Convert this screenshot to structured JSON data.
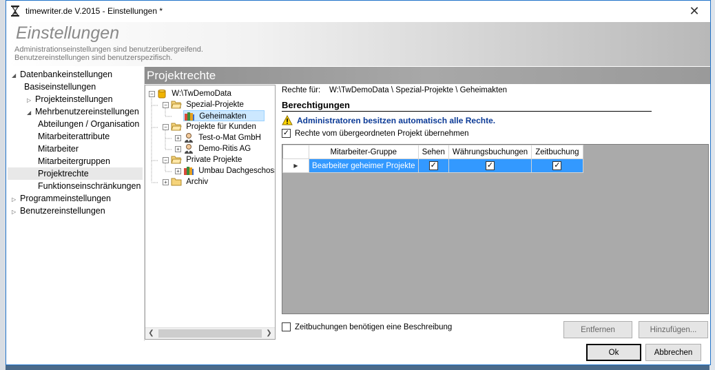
{
  "window": {
    "title": "timewriter.de V.2015 - Einstellungen *",
    "close_glyph": "✕"
  },
  "banner": {
    "heading": "Einstellungen",
    "line1": "Administrationseinstellungen sind benutzerübergreifend.",
    "line2": "Benutzereinstellungen sind benutzerspezifisch."
  },
  "nav": {
    "items": [
      {
        "label": "Datenbankeinstellungen",
        "tri": "◢"
      },
      {
        "label": "Basiseinstellungen"
      },
      {
        "label": "Projekteinstellungen",
        "tri": "▷"
      },
      {
        "label": "Mehrbenutzereinstellungen",
        "tri": "◢"
      },
      {
        "label": "Abteilungen / Organisation"
      },
      {
        "label": "Mitarbeiterattribute"
      },
      {
        "label": "Mitarbeiter"
      },
      {
        "label": "Mitarbeitergruppen"
      },
      {
        "label": "Projektrechte"
      },
      {
        "label": "Funktionseinschränkungen"
      },
      {
        "label": "Programmeinstellungen",
        "tri": "▷"
      },
      {
        "label": "Benutzereinstellungen",
        "tri": "▷"
      }
    ]
  },
  "content": {
    "header": "Projektrechte"
  },
  "ptree": {
    "nodes": [
      {
        "label": "W:\\TwDemoData"
      },
      {
        "label": "Spezial-Projekte"
      },
      {
        "label": "Geheimakten"
      },
      {
        "label": "Projekte für Kunden"
      },
      {
        "label": "Test-o-Mat GmbH"
      },
      {
        "label": "Demo-Ritis AG"
      },
      {
        "label": "Private Projekte"
      },
      {
        "label": "Umbau Dachgeschoss"
      },
      {
        "label": "Archiv"
      }
    ]
  },
  "rights": {
    "path_label": "Rechte für:",
    "path": "W:\\TwDemoData \\ Spezial-Projekte \\ Geheimakten",
    "section_title": "Berechtigungen",
    "admin_notice": "Administratoren besitzen automatisch alle Rechte.",
    "inherit_label": "Rechte vom übergeordneten Projekt übernehmen",
    "inherit_checked": "✓",
    "description_label": "Zeitbuchungen benötigen eine Beschreibung",
    "description_checked": ""
  },
  "grid": {
    "columns": [
      "Mitarbeiter-Gruppe",
      "Sehen",
      "Währungsbuchungen",
      "Zeitbuchung"
    ],
    "rows": [
      {
        "group": "Bearbeiter geheimer Projekte",
        "sehen": "✓",
        "waehrung": "✓",
        "zeit": "✓",
        "marker": "▶"
      }
    ]
  },
  "buttons": {
    "remove": "Entfernen",
    "add": "Hinzufügen...",
    "ok": "Ok",
    "cancel": "Abbrechen"
  },
  "colors": {
    "selection": "#3399ff",
    "warning": "#ffd500",
    "notice_text": "#0b3a96"
  }
}
